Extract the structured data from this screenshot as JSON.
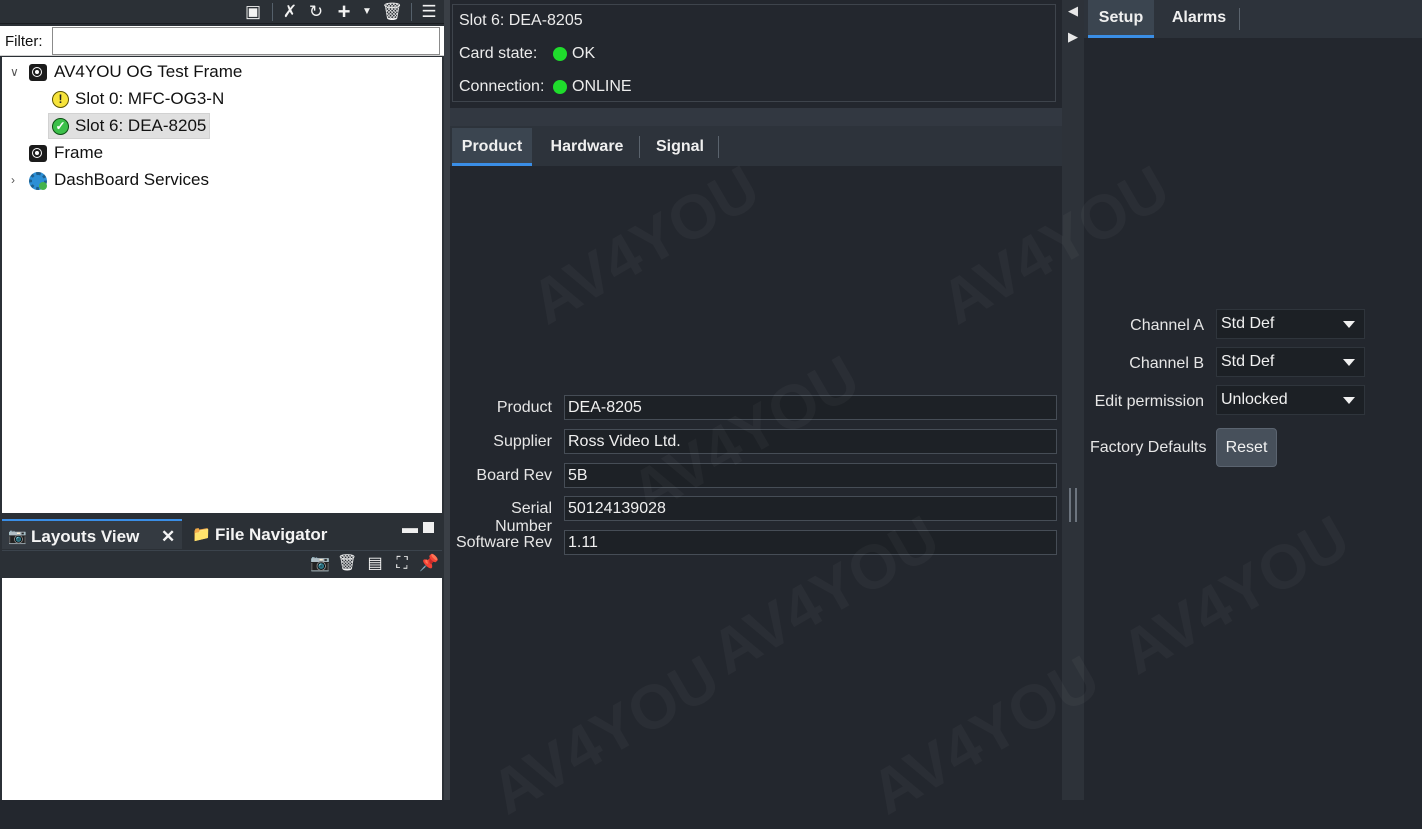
{
  "left": {
    "filter": {
      "label": "Filter:",
      "value": ""
    },
    "tree": [
      {
        "label": "AV4YOU OG Test Frame",
        "expanded": true
      },
      {
        "label": "Slot 0: MFC-OG3-N",
        "status": "warning"
      },
      {
        "label": "Slot 6: DEA-8205",
        "status": "ok",
        "selected": true
      },
      {
        "label": "Frame"
      },
      {
        "label": "DashBoard Services",
        "expanded": false
      }
    ],
    "bottom_tabs": {
      "layouts": "Layouts View",
      "file_nav": "File Navigator"
    }
  },
  "card": {
    "title": "Slot 6: DEA-8205",
    "state_label": "Card state:",
    "state_value": "OK",
    "connection_label": "Connection:",
    "connection_value": "ONLINE"
  },
  "center_tabs": [
    "Product",
    "Hardware",
    "Signal"
  ],
  "product": {
    "fields": [
      {
        "label": "Product",
        "value": "DEA-8205"
      },
      {
        "label": "Supplier",
        "value": "Ross Video Ltd."
      },
      {
        "label": "Board Rev",
        "value": "5B"
      },
      {
        "label": "Serial Number",
        "value": "50124139028"
      },
      {
        "label": "Software Rev",
        "value": "1.11"
      }
    ]
  },
  "right": {
    "tabs": [
      "Setup",
      "Alarms"
    ],
    "channel_a": {
      "label": "Channel A",
      "value": "Std Def"
    },
    "channel_b": {
      "label": "Channel B",
      "value": "Std Def"
    },
    "edit_permission": {
      "label": "Edit permission",
      "value": "Unlocked"
    },
    "factory_defaults": {
      "label": "Factory Defaults",
      "button": "Reset"
    }
  },
  "watermark": "AV4YOU",
  "colors": {
    "accent": "#3a8ee6",
    "led_green": "#1fdc2c",
    "panel_bg": "#23272e"
  }
}
